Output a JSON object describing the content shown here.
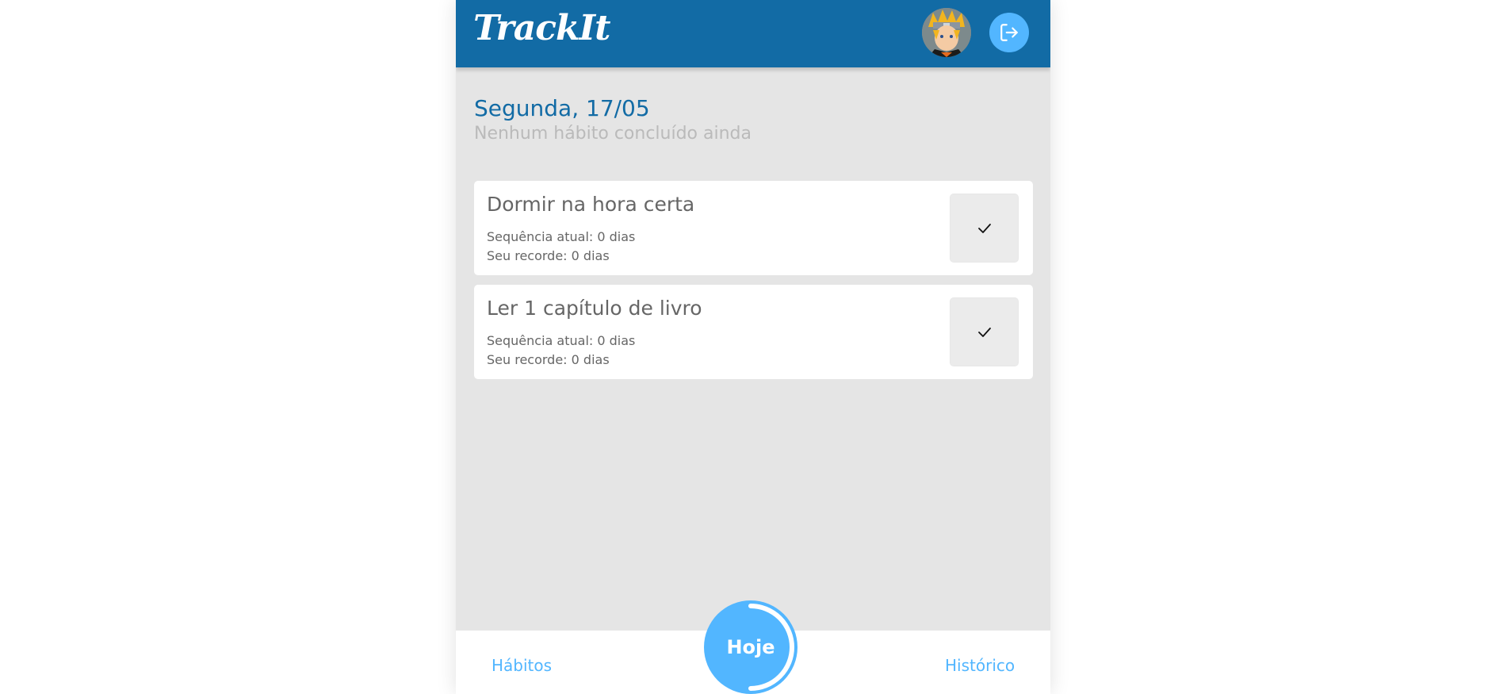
{
  "header": {
    "logo": "TrackIt",
    "avatar_icon": "naruto-avatar-icon",
    "logout_icon": "logout-icon"
  },
  "today": {
    "date": "Segunda, 17/05",
    "status": "Nenhum hábito concluído ainda",
    "progress_fraction": 0.0
  },
  "habits": [
    {
      "name": "Dormir na hora certa",
      "current_streak": "Sequência atual: 0 dias",
      "record": "Seu recorde: 0 dias",
      "done": false
    },
    {
      "name": "Ler 1 capítulo de livro",
      "current_streak": "Sequência atual: 0 dias",
      "record": "Seu recorde: 0 dias",
      "done": false
    }
  ],
  "footer": {
    "habits_link": "Hábitos",
    "today_button": "Hoje",
    "history_link": "Histórico"
  },
  "colors": {
    "header": "#126ba5",
    "accent": "#52b6ff",
    "background": "#e5e5e5",
    "text": "#666666",
    "muted": "#bababa"
  }
}
